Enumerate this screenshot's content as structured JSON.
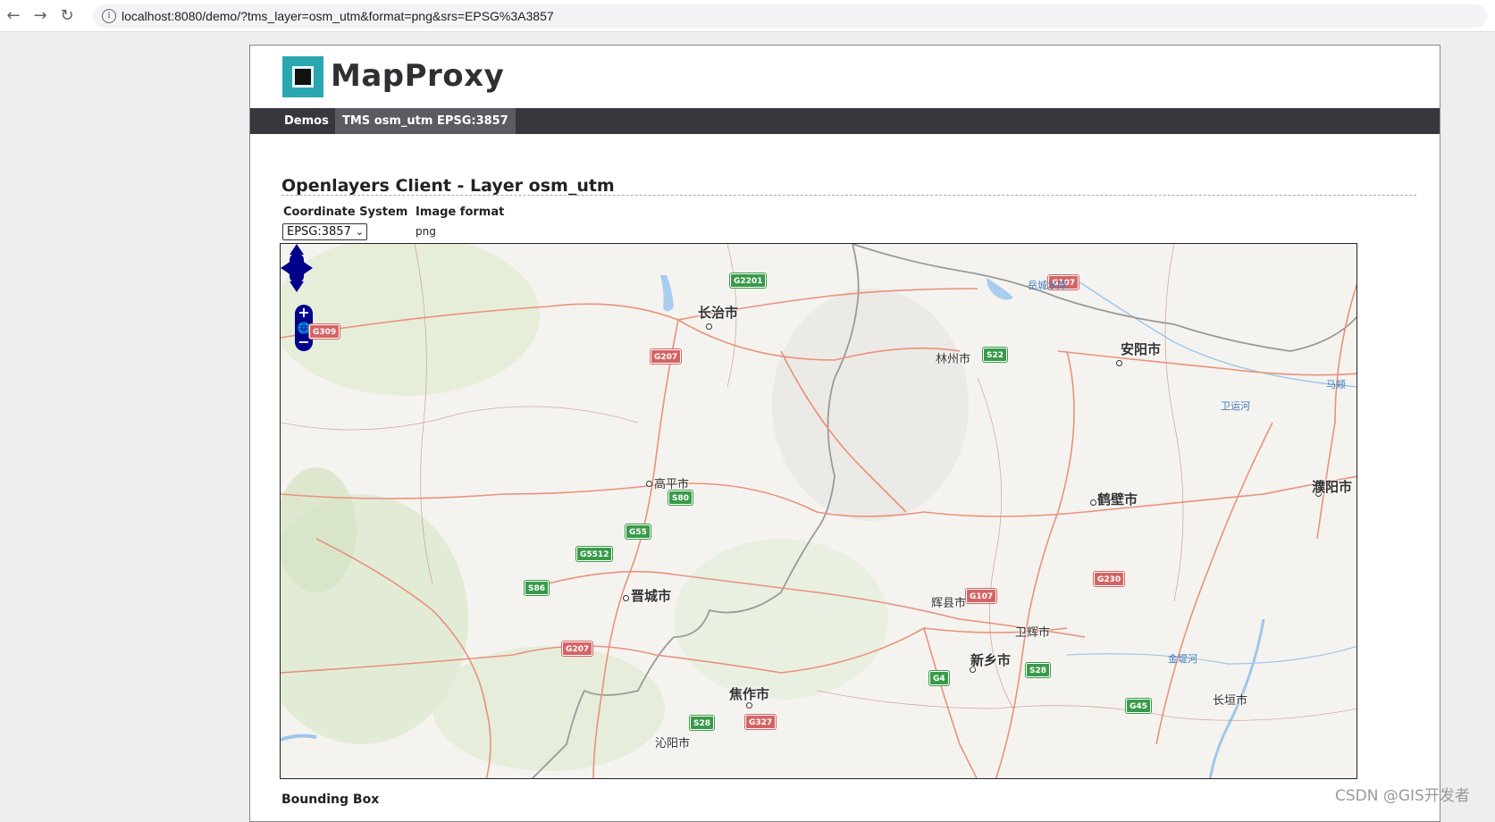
{
  "browser": {
    "back": "←",
    "forward": "→",
    "reload": "↻",
    "info": "i",
    "url": "localhost:8080/demo/?tms_layer=osm_utm&format=png&srs=EPSG%3A3857"
  },
  "header": {
    "logo_text": "MapProxy"
  },
  "nav": {
    "demos": "Demos",
    "active": "TMS osm_utm EPSG:3857"
  },
  "main": {
    "heading": "Openlayers Client - Layer osm_utm",
    "coordinate_system_label": "Coordinate System",
    "coordinate_system_value": "EPSG:3857",
    "image_format_label": "Image format",
    "image_format_value": "png",
    "bounding_box_label": "Bounding Box"
  },
  "map": {
    "zoom_in": "+",
    "zoom_out": "−",
    "cities": {
      "changzhi": "长治市",
      "anyang": "安阳市",
      "linzhou": "林州市",
      "gaoping": "高平市",
      "hebi": "鹤壁市",
      "puyang": "濮阳市",
      "jincheng": "晋城市",
      "huixian": "辉县市",
      "weihui": "卫辉市",
      "xinxiang": "新乡市",
      "jiaozuo": "焦作市",
      "changyuan": "长垣市",
      "qinyang": "沁阳市"
    },
    "water": {
      "yuecheng": "岳城水库",
      "weiyunhe": "卫运河",
      "jindihe": "金堤河",
      "majia": "马颊"
    },
    "shields": {
      "g2201": "G2201",
      "g107a": "G107",
      "g309": "G309",
      "g207a": "G207",
      "s22": "S22",
      "s80": "S80",
      "g55": "G55",
      "g5512": "G5512",
      "s86": "S86",
      "g230": "G230",
      "g107b": "G107",
      "g207b": "G207",
      "s28a": "S28",
      "g4": "G4",
      "g45": "G45",
      "s28b": "S28",
      "g327": "G327"
    }
  },
  "watermark": "CSDN @GIS开发者"
}
